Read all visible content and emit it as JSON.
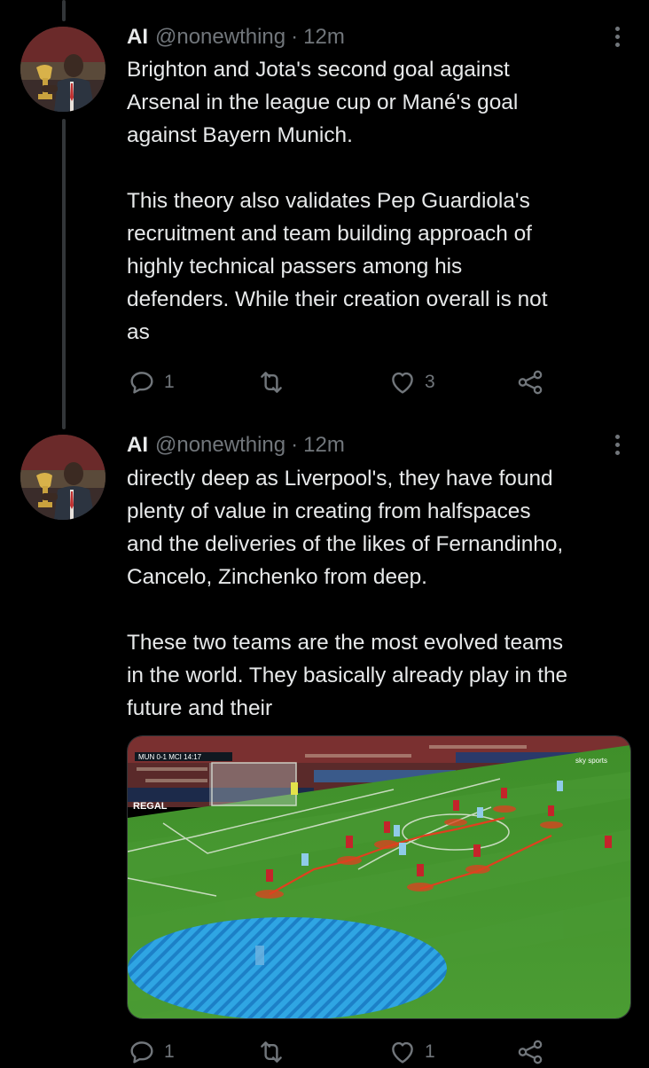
{
  "tweets": [
    {
      "display_name": "AI",
      "handle": "@nonewthing",
      "separator": "·",
      "time": "12m",
      "text": "Brighton and Jota's second goal against\nArsenal in the league cup or Mané's goal\nagainst Bayern Munich.\n\nThis theory also validates Pep Guardiola's\nrecruitment and team building approach of\nhighly technical passers among his\ndefenders. While their creation overall is not\nas",
      "reply_count": "1",
      "retweet_count": "",
      "like_count": "3"
    },
    {
      "display_name": "AI",
      "handle": "@nonewthing",
      "separator": "·",
      "time": "12m",
      "text": "directly deep as Liverpool's, they have found\nplenty of value in creating from halfspaces\nand the deliveries of the likes of Fernandinho,\nCancelo, Zinchenko from deep.\n\nThese two teams are the most evolved teams\nin the world. They basically already play in the\nfuture and their",
      "reply_count": "1",
      "retweet_count": "",
      "like_count": "1",
      "media": {
        "scoreboard": "MUN 0-1 MCI  14:17",
        "sponsor_board": "REGAL",
        "broadcaster": "sky sports"
      }
    }
  ],
  "colors": {
    "background": "#000000",
    "text": "#e7e9ea",
    "secondary": "#71767b",
    "thread_line": "#333639",
    "pitch": "#3f8f2a",
    "highlight_red": "#e0401f",
    "highlight_blue": "#1e90e0"
  },
  "icons": [
    "reply-icon",
    "retweet-icon",
    "like-icon",
    "share-icon",
    "more-icon"
  ]
}
